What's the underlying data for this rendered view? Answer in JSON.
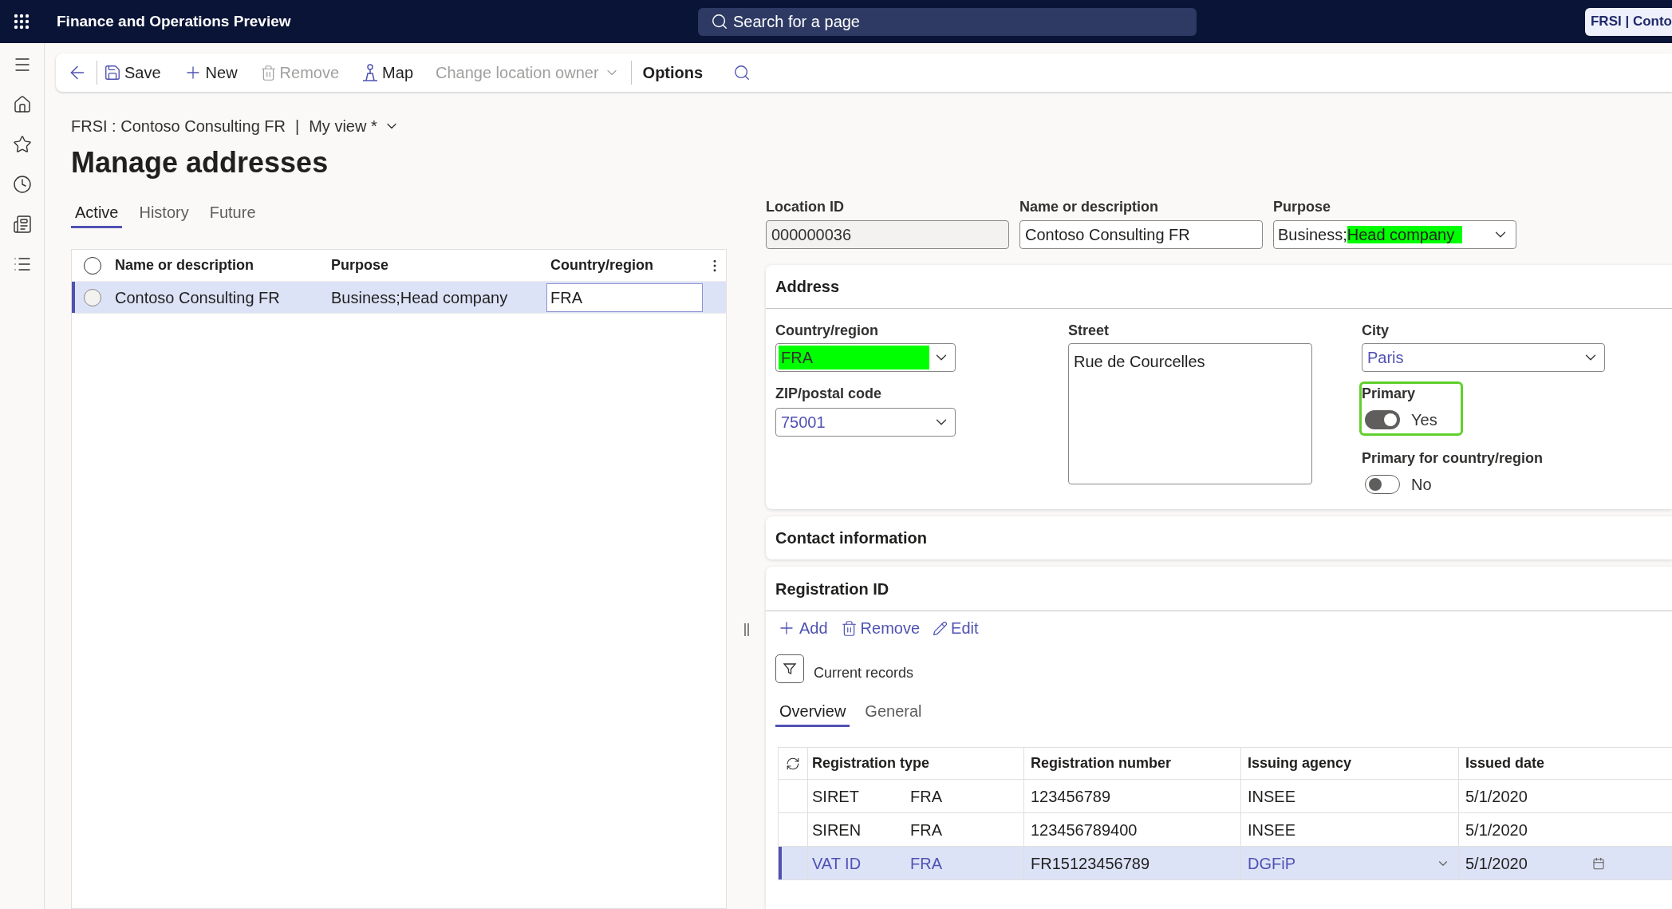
{
  "app_bar": {
    "title": "Finance and Operations Preview",
    "search": {
      "placeholder": "Search for a page"
    },
    "company_badge": "FRSI | Conto"
  },
  "toolbar": {
    "items": [
      {
        "kind": "save",
        "label": "Save",
        "disabled": false
      },
      {
        "kind": "add",
        "label": "New",
        "disabled": false
      },
      {
        "kind": "delete",
        "label": "Remove",
        "disabled": true
      },
      {
        "kind": "map",
        "label": "Map",
        "disabled": false
      },
      {
        "kind": "dropdown",
        "label": "Change location owner",
        "disabled": true
      },
      {
        "kind": "menu",
        "label": "Options",
        "disabled": false
      }
    ]
  },
  "breadcrumb": {
    "company": "FRSI : Contoso Consulting FR",
    "separator": "|",
    "view": "My view *"
  },
  "page_title": "Manage addresses",
  "tabs": [
    {
      "label": "Active",
      "selected": true
    },
    {
      "label": "History",
      "selected": false
    },
    {
      "label": "Future",
      "selected": false
    }
  ],
  "address_grid": {
    "all_selected": false,
    "columns": [
      "Name or description",
      "Purpose",
      "Country/region"
    ],
    "rows": [
      {
        "name_or_description": "Contoso Consulting FR",
        "purpose": "Business;Head company",
        "country_region": "FRA",
        "selected": true,
        "checked": false
      }
    ]
  },
  "header_fields": {
    "location_id": {
      "label": "Location ID",
      "value": "000000036",
      "read_only": true
    },
    "name_or_description": {
      "label": "Name or description",
      "value": "Contoso Consulting FR",
      "read_only": false
    },
    "purpose": {
      "label": "Purpose",
      "value": [
        {
          "text": "Business;",
          "highlighted": false
        },
        {
          "text": "Head company",
          "highlighted": true
        }
      ]
    }
  },
  "address": {
    "title": "Address",
    "country_region": {
      "label": "Country/region",
      "value": "FRA",
      "highlighted": true
    },
    "zip_postal_code": {
      "label": "ZIP/postal code",
      "value": "75001"
    },
    "street": {
      "label": "Street",
      "value": "Rue de Courcelles"
    },
    "city": {
      "label": "City",
      "value": "Paris"
    },
    "primary": {
      "label": "Primary",
      "on": true,
      "state_text": "Yes",
      "outlined": true
    },
    "primary_for_country_region": {
      "label": "Primary for country/region",
      "on": false,
      "state_text": "No",
      "outlined": false
    }
  },
  "contact_information": {
    "title": "Contact information"
  },
  "registration_id": {
    "title": "Registration ID",
    "actions": [
      {
        "kind": "add",
        "label": "Add"
      },
      {
        "kind": "delete",
        "label": "Remove"
      },
      {
        "kind": "edit",
        "label": "Edit"
      }
    ],
    "filter": {
      "label": "Current records"
    },
    "tabs": [
      {
        "label": "Overview",
        "selected": true
      },
      {
        "label": "General",
        "selected": false
      }
    ],
    "grid": {
      "columns": [
        "Registration type",
        "Registration number",
        "Issuing agency",
        "Issued date"
      ],
      "rows": [
        {
          "registration_type": "SIRET",
          "column_2": "FRA",
          "registration_number": "123456789",
          "issuing_agency": "INSEE",
          "issued_date": "5/1/2020",
          "selected": false
        },
        {
          "registration_type": "SIREN",
          "column_2": "FRA",
          "registration_number": "123456789400",
          "issuing_agency": "INSEE",
          "issued_date": "5/1/2020",
          "selected": false
        },
        {
          "registration_type": "VAT ID",
          "column_2": "FRA",
          "registration_number": "FR15123456789",
          "issuing_agency": "DGFiP",
          "issued_date": "5/1/2020",
          "selected": true
        }
      ]
    }
  }
}
